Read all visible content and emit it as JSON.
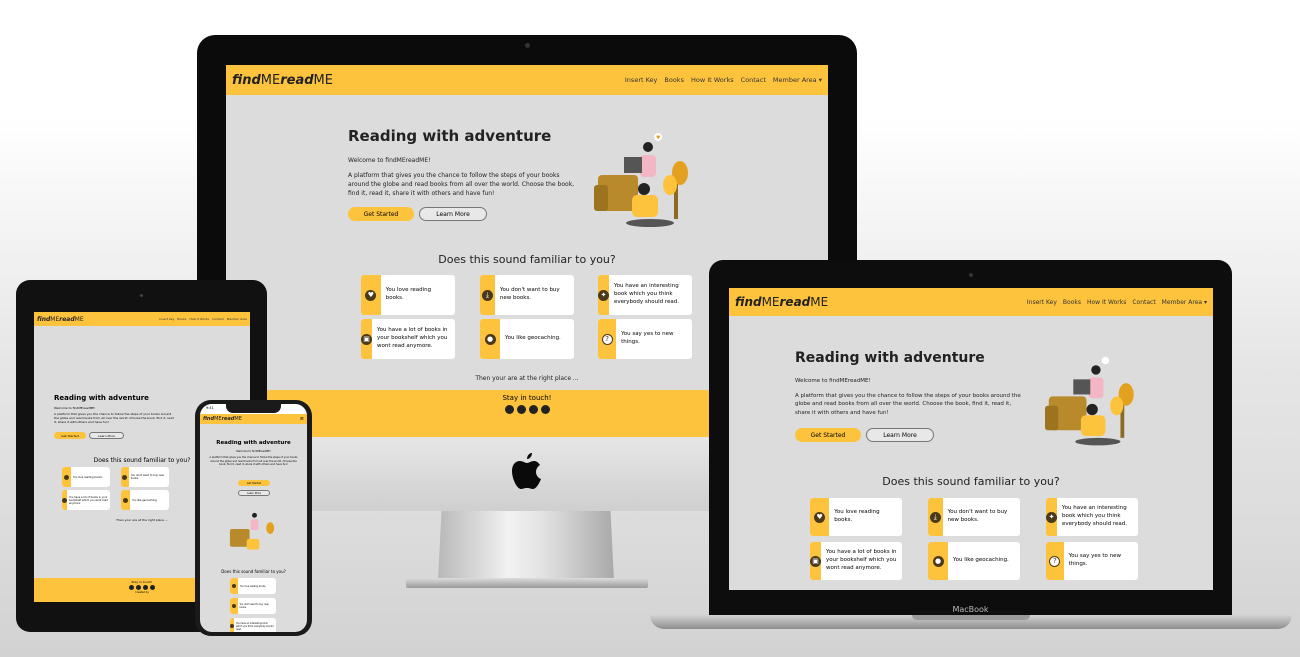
{
  "site": {
    "logo_find": "find",
    "logo_me1": "ME",
    "logo_read": "read",
    "logo_me2": "ME",
    "nav": [
      "Insert Key",
      "Books",
      "How It Works",
      "Contact",
      "Member Area"
    ],
    "hero_title": "Reading with adventure",
    "welcome": "Welcome to findMEreadME!",
    "hero_text": "A platform that gives you the chance to follow the steps of your books around the globe and read books from all over the world. Choose the book, find it, read it, share it with others and have fun!",
    "get_started": "Get Started",
    "learn_more": "Learn More",
    "familiar_title": "Does this sound familiar to you?",
    "cards": [
      {
        "icon": "heart-icon",
        "glyph": "♥",
        "text": "You love reading books."
      },
      {
        "icon": "download-icon",
        "glyph": "⤓",
        "text": "You don't want to buy new books."
      },
      {
        "icon": "lightbulb-icon",
        "glyph": "✦",
        "text": "You have an interesting book which you think everybody should read."
      },
      {
        "icon": "trash-icon",
        "glyph": "▣",
        "text": "You have a lot of books in your bookshelf which you wont read anymore."
      },
      {
        "icon": "location-pin-icon",
        "glyph": "●",
        "text": "You like geocaching."
      },
      {
        "icon": "question-icon",
        "glyph": "?",
        "text": "You say yes to new things."
      }
    ],
    "right_place": "Then your are at the right place ...",
    "stay_in_touch": "Stay in touch!",
    "created_by": "Created by"
  },
  "device": {
    "macbook_label": "MacBook",
    "iphone_time": "9:41"
  },
  "colors": {
    "accent": "#fdc33d",
    "screen_bg": "#dcdcdc",
    "text_dark": "#222222"
  }
}
